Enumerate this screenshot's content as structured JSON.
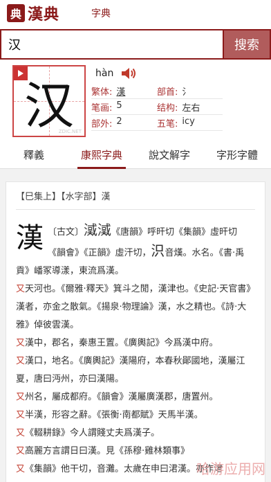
{
  "header": {
    "logo_glyph": "典",
    "logo_text": "漢典",
    "subtitle": "字典"
  },
  "search": {
    "value": "汉",
    "button_label": "搜索"
  },
  "character": {
    "glyph": "汉",
    "watermark": "ZDIC.NET",
    "pinyin": "hàn",
    "fields": [
      {
        "label": "繁体:",
        "value": "漢",
        "label2": "部首:",
        "value2": "氵"
      },
      {
        "label": "笔画:",
        "value": "5",
        "label2": "结构:",
        "value2": "左右"
      },
      {
        "label": "部外:",
        "value": "2",
        "label2": "五笔:",
        "value2": "icy"
      }
    ]
  },
  "tabs": [
    "釋義",
    "康熙字典",
    "說文解字",
    "字形字體"
  ],
  "active_tab": 1,
  "card": {
    "header": "【巳集上】【水字部】漢",
    "big_char": "漢",
    "lines": [
      "〔古文〕",
      "《唐韻》呼旰切《集韻》虛",
      "旰切《韻會》《正韻》虛汗切，",
      "音熯。水名。《書·禹貢》嶓冢導漾，東流爲漢。",
      "又",
      "天河也。《爾雅·釋天》箕斗之閒，漢津也。《史記·天官書》漢者，亦金之散氣。《揚泉·物理論》漢，水之精也。《詩·大雅》倬彼雲漢。",
      "又",
      "漢中，郡名，秦惠王置。《廣輿記》今爲漢中府。",
      "又",
      "漢口，地名。《廣輿記》漢陽府，本春秋鄖國地，漢屬江夏，唐曰沔州，亦曰漢陽。",
      "又",
      "州名，屬成都府。《韻會》漢屬廣漢郡，唐置州。",
      "又",
      "半漢，形容之辭。《張衡·南都賦》天馬半漢。",
      "又",
      "《輟耕錄》今人謂賤丈夫爲漢子。",
      "又",
      "高麗方言謂日曰漢。見《孫穆·雞林類事》",
      "又",
      "《集韻》他干切，音灘。太歲在申曰涒漢。亦作涒"
    ],
    "ancient_glyphs": "㵄㵄",
    "inline_glyph": "𣲵"
  },
  "watermark": "哈游应用网",
  "colors": {
    "brand": "#8b1a1a",
    "accent_red": "#c0392b",
    "search_button": "#b15c5c"
  }
}
